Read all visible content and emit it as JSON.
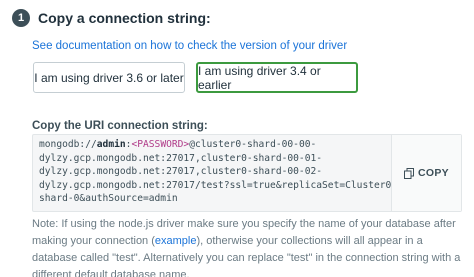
{
  "step": {
    "number": "1",
    "title": "Copy a connection string:"
  },
  "doc_link": "See documentation on how to check the version of your driver",
  "driver_options": [
    {
      "label": "I am using driver 3.6 or later",
      "selected": false
    },
    {
      "label": "I am using driver 3.4 or earlier",
      "selected": true
    }
  ],
  "uri_section": {
    "title": "Copy the URI connection string:",
    "code": {
      "prefix": "mongodb://",
      "user": "admin",
      "colon": ":",
      "password": "<PASSWORD>",
      "rest_line1": "@cluster0-shard-00-00-",
      "line2": "dylzy.gcp.mongodb.net:27017,cluster0-shard-00-01-",
      "line3": "dylzy.gcp.mongodb.net:27017,cluster0-shard-00-02-",
      "line4": "dylzy.gcp.mongodb.net:27017/test?ssl=true&replicaSet=Cluster0-",
      "line5": "shard-0&authSource=admin"
    },
    "copy_label": "COPY"
  },
  "note": {
    "part1": "Note: If using the node.js driver make sure you specify the name of your database after making your connection (",
    "link": "example",
    "part2": "), otherwise your collections will all appear in a database called \"test\". Alternatively you can replace \"test\" in the connection string with a different default database name."
  },
  "colors": {
    "selected_border": "#3c9a3f",
    "link": "#1a73d8",
    "password": "#b03a88"
  }
}
